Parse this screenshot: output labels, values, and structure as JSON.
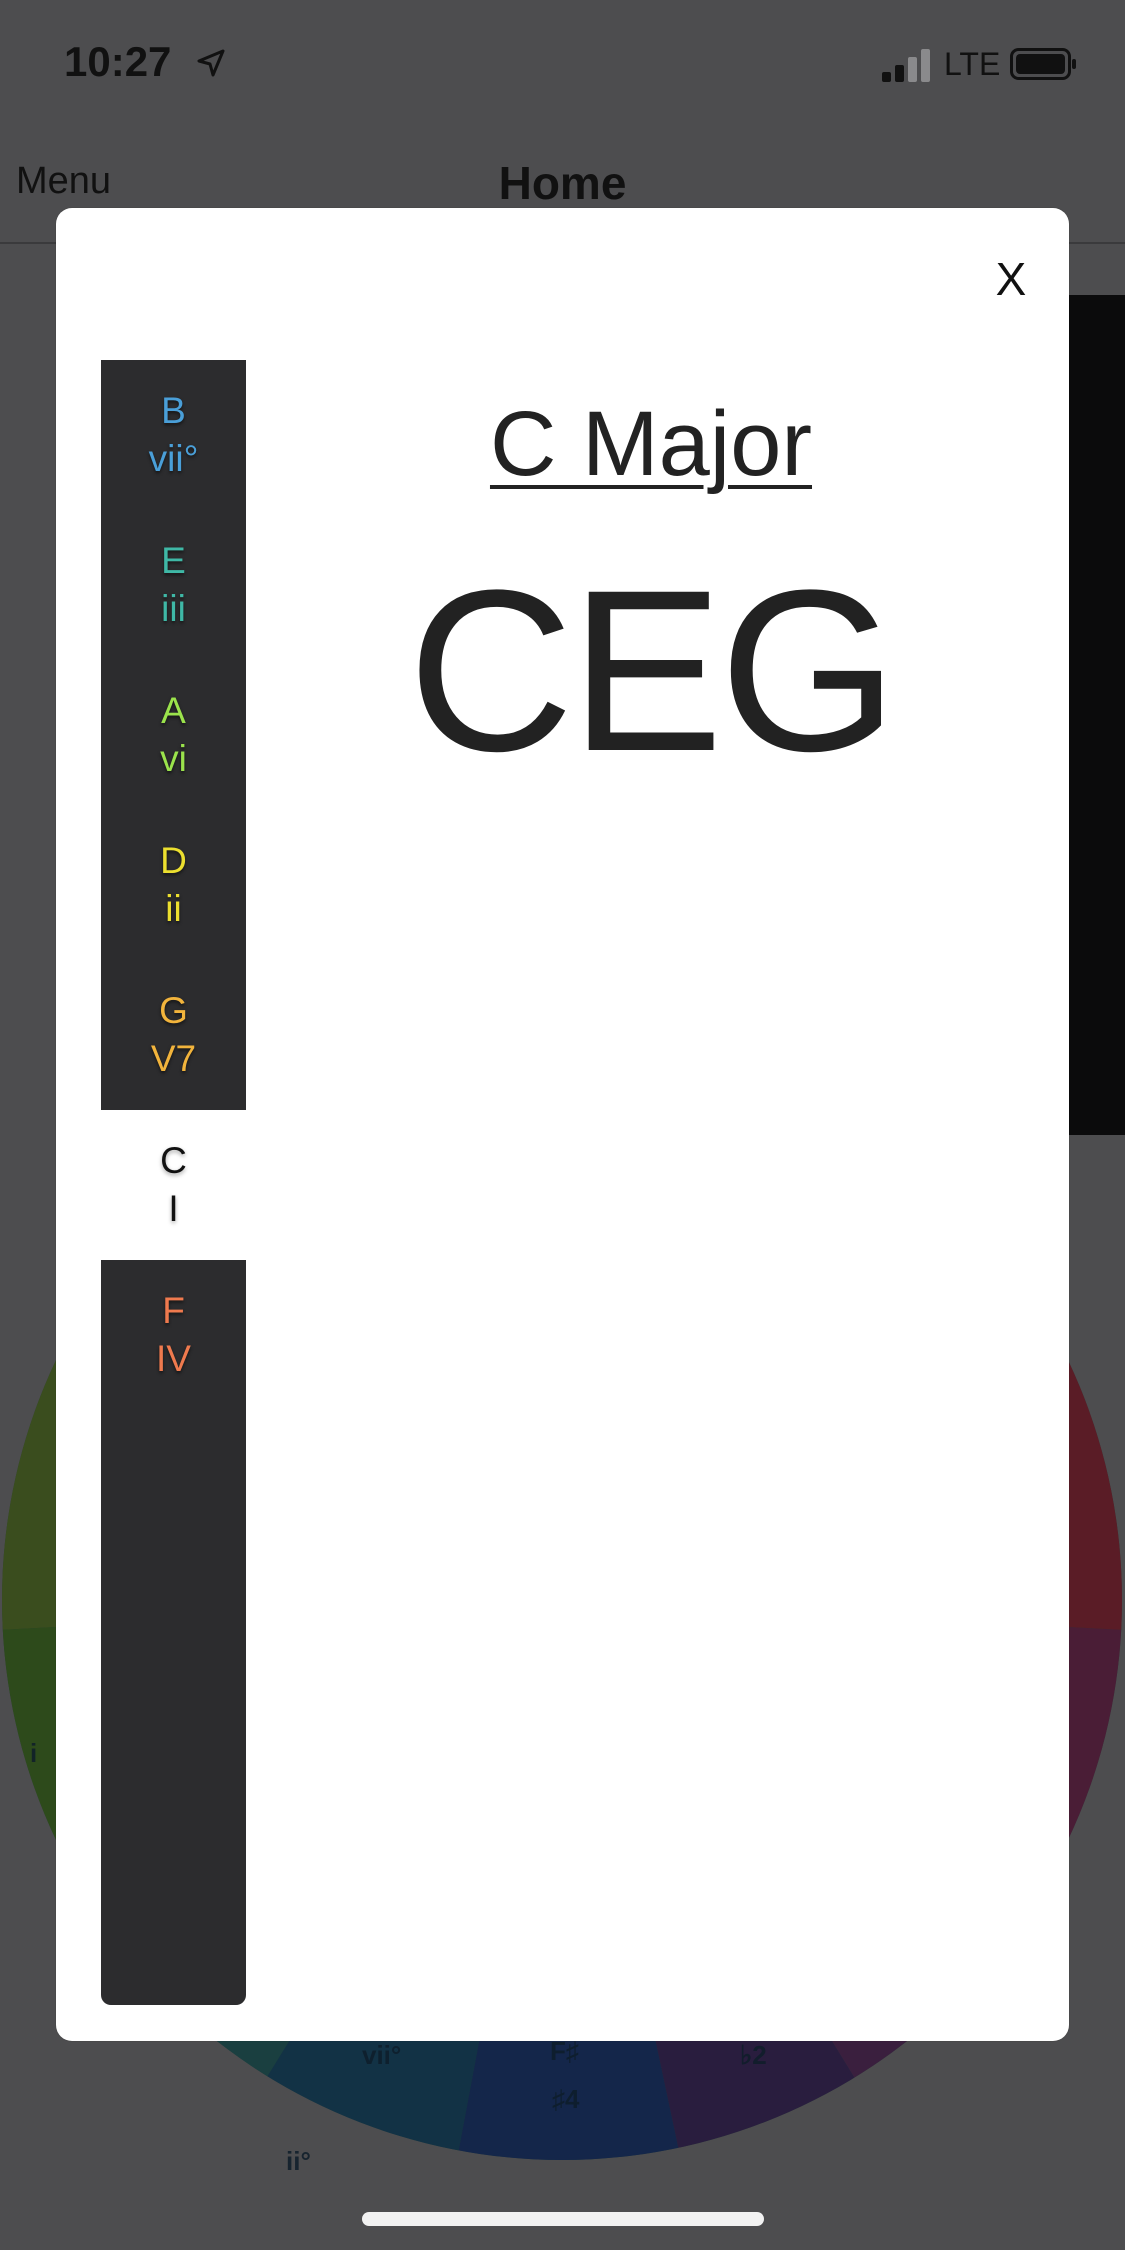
{
  "status_bar": {
    "time": "10:27",
    "carrier": "LTE",
    "icons": [
      "location-arrow-icon",
      "signal-bars-icon",
      "battery-icon"
    ]
  },
  "nav": {
    "menu_label": "Menu",
    "title": "Home"
  },
  "wheel_labels": {
    "i": "i",
    "vii_dim": "vii°",
    "f_sharp": "F♯",
    "sharp4": "♯4",
    "flat2": "♭2",
    "ii_dim": "ii°"
  },
  "modal": {
    "close_label": "X",
    "chord_title": "C Major",
    "chord_notes": "CEG",
    "chords": [
      {
        "note": "B",
        "numeral": "vii°",
        "color": "#4a9fd8",
        "active": false
      },
      {
        "note": "E",
        "numeral": "iii",
        "color": "#3fb8a6",
        "active": false
      },
      {
        "note": "A",
        "numeral": "vi",
        "color": "#9be34c",
        "active": false
      },
      {
        "note": "D",
        "numeral": "ii",
        "color": "#ecdf2f",
        "active": false
      },
      {
        "note": "G",
        "numeral": "V7",
        "color": "#f2b43c",
        "active": false
      },
      {
        "note": "C",
        "numeral": "I",
        "color": "#111111",
        "active": true
      },
      {
        "note": "F",
        "numeral": "IV",
        "color": "#ef7a4e",
        "active": false
      }
    ]
  }
}
